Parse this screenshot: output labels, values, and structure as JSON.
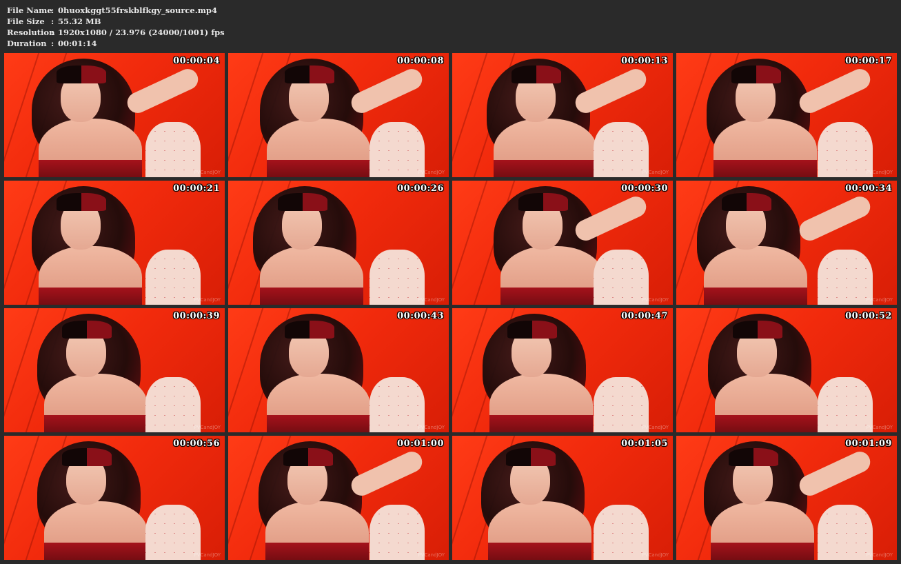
{
  "info": {
    "file_name_label": "File Name",
    "file_name": "0huoxkggt55frskblfkgy_source.mp4",
    "file_size_label": "File Size",
    "file_size": "55.32 MB",
    "resolution_label": "Resolution",
    "resolution": "1920x1080 / 23.976 (24000/1001) fps",
    "duration_label": "Duration",
    "duration": "00:01:14",
    "separator": ":"
  },
  "thumbnails": [
    {
      "timestamp": "00:00:04",
      "watermark": "PVCandJOY"
    },
    {
      "timestamp": "00:00:08",
      "watermark": "PVCandJOY"
    },
    {
      "timestamp": "00:00:13",
      "watermark": "PVCandJOY"
    },
    {
      "timestamp": "00:00:17",
      "watermark": "PVCandJOY"
    },
    {
      "timestamp": "00:00:21",
      "watermark": "PVCandJOY"
    },
    {
      "timestamp": "00:00:26",
      "watermark": "PVCandJOY"
    },
    {
      "timestamp": "00:00:30",
      "watermark": "PVCandJOY"
    },
    {
      "timestamp": "00:00:34",
      "watermark": "PVCandJOY"
    },
    {
      "timestamp": "00:00:39",
      "watermark": "PVCandJOY"
    },
    {
      "timestamp": "00:00:43",
      "watermark": "PVCandJOY"
    },
    {
      "timestamp": "00:00:47",
      "watermark": "PVCandJOY"
    },
    {
      "timestamp": "00:00:52",
      "watermark": "PVCandJOY"
    },
    {
      "timestamp": "00:00:56",
      "watermark": "PVCandJOY"
    },
    {
      "timestamp": "00:01:00",
      "watermark": "PVCandJOY"
    },
    {
      "timestamp": "00:01:05",
      "watermark": "PVCandJOY"
    },
    {
      "timestamp": "00:01:09",
      "watermark": "PVCandJOY"
    }
  ],
  "colors": {
    "background": "#2a2a2a",
    "header_text": "#e8e8e8",
    "frame_backdrop": "#f12a0c"
  }
}
